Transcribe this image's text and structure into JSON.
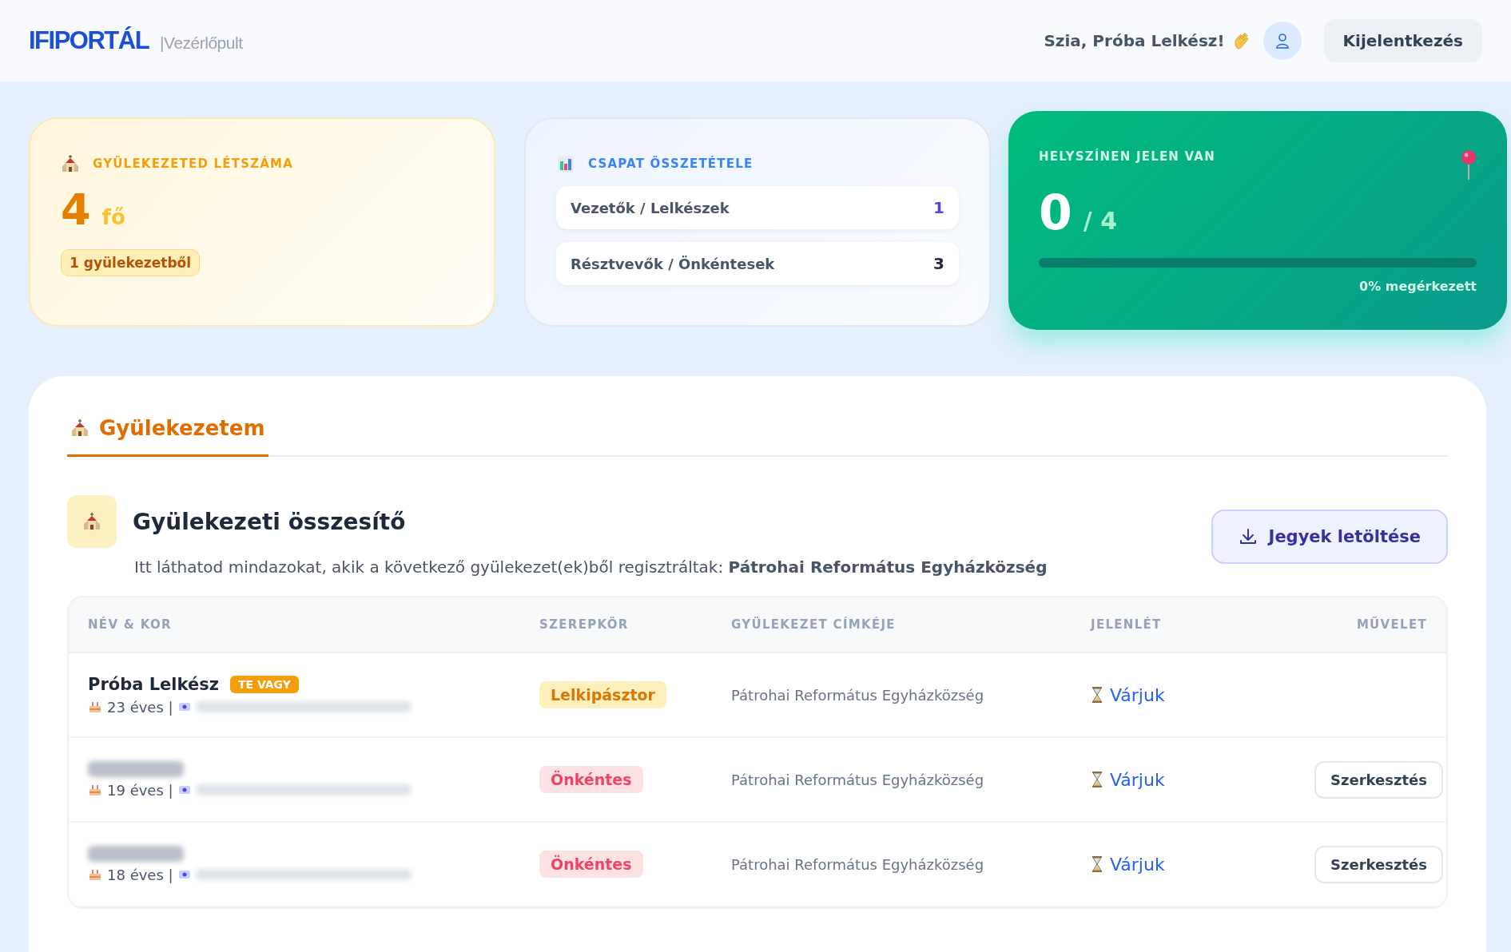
{
  "header": {
    "logo": "IFIPORTÁL",
    "subtitle": "|Vezérlőpult",
    "greeting": "Szia, Próba Lelkész!",
    "logout": "Kijelentkezés"
  },
  "cards": {
    "count": {
      "title": "GYÜLEKEZETED LÉTSZÁMA",
      "value": "4",
      "unit": "fő",
      "badge": "1 gyülekezetből"
    },
    "team": {
      "title": "CSAPAT ÖSSZETÉTELE",
      "rows": [
        {
          "label": "Vezetők / Lelkészek",
          "value": "1",
          "kind": "leader"
        },
        {
          "label": "Résztvevők / Önkéntesek",
          "value": "3",
          "kind": "participant"
        }
      ]
    },
    "presence": {
      "title": "HELYSZÍNEN JELEN VAN",
      "value": "0",
      "total": "/ 4",
      "level": 0,
      "caption": "0% megérkezett"
    }
  },
  "tabs": [
    {
      "label": "Gyülekezetem",
      "selected": true
    }
  ],
  "summary": {
    "title": "Gyülekezeti összesítő",
    "text": "Itt láthatod mindazokat, akik a következő gyülekezet(ek)ből regisztráltak: **Pátrohai Református Egyházközség**",
    "download": "Jegyek letöltése"
  },
  "table": {
    "columns": [
      "NÉV & KOR",
      "SZEREPKÖR",
      "GYÜLEKEZET CÍMKÉJE",
      "JELENLÉT",
      "MŰVELET"
    ],
    "rows": [
      {
        "name": "Próba Lelkész",
        "you": "TE VAGY",
        "age": "23 éves |",
        "role": "Lelkipásztor",
        "kind": "leader",
        "church": "Pátrohai Református Egyházközség",
        "presence": "Várjuk"
      },
      {
        "age": "19 éves |",
        "role": "Önkéntes",
        "kind": "volunteer",
        "church": "Pátrohai Református Egyházközség",
        "presence": "Várjuk",
        "action": "Szerkesztés"
      },
      {
        "age": "18 éves |",
        "role": "Önkéntes",
        "kind": "volunteer",
        "church": "Pátrohai Református Egyházközség",
        "presence": "Várjuk",
        "action": "Szerkesztés"
      }
    ]
  }
}
